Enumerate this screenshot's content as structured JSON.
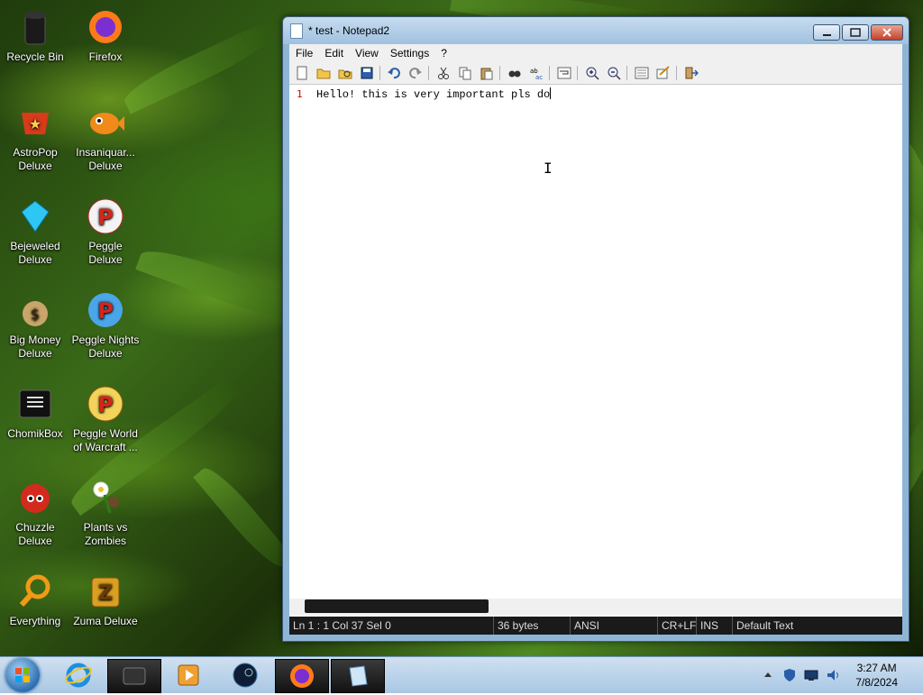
{
  "desktop": {
    "icons": [
      {
        "label": "Recycle Bin",
        "icon": "recycle-bin-icon"
      },
      {
        "label": "Firefox",
        "icon": "firefox-icon"
      },
      {
        "label": "AstroPop Deluxe",
        "icon": "astropop-icon"
      },
      {
        "label": "Insaniquar... Deluxe",
        "icon": "insaniquarium-icon"
      },
      {
        "label": "Bejeweled Deluxe",
        "icon": "bejeweled-icon"
      },
      {
        "label": "Peggle Deluxe",
        "icon": "peggle-icon"
      },
      {
        "label": "Big Money Deluxe",
        "icon": "big-money-icon"
      },
      {
        "label": "Peggle Nights Deluxe",
        "icon": "peggle-nights-icon"
      },
      {
        "label": "ChomikBox",
        "icon": "chomikbox-icon"
      },
      {
        "label": "Peggle World of Warcraft ...",
        "icon": "peggle-wow-icon"
      },
      {
        "label": "Chuzzle Deluxe",
        "icon": "chuzzle-icon"
      },
      {
        "label": "Plants vs Zombies",
        "icon": "plants-vs-zombies-icon"
      },
      {
        "label": "Everything",
        "icon": "everything-icon"
      },
      {
        "label": "Zuma Deluxe",
        "icon": "zuma-icon"
      }
    ]
  },
  "window": {
    "title": "* test - Notepad2",
    "menu": [
      "File",
      "Edit",
      "View",
      "Settings",
      "?"
    ],
    "toolbar": [
      "new-icon",
      "open-icon",
      "browse-icon",
      "save-icon",
      "undo-icon",
      "redo-icon",
      "cut-icon",
      "copy-icon",
      "paste-icon",
      "find-icon",
      "replace-icon",
      "word-wrap-icon",
      "zoom-in-icon",
      "zoom-out-icon",
      "scheme-icon",
      "customize-icon",
      "exit-icon"
    ],
    "editor": {
      "line_number": "1",
      "text": "Hello! this is very important pls do"
    },
    "status": {
      "position": "Ln 1 : 1   Col 37   Sel 0",
      "size": "36 bytes",
      "encoding": "ANSI",
      "eol": "CR+LF",
      "mode": "INS",
      "scheme": "Default Text"
    }
  },
  "taskbar": {
    "apps": [
      "start-orb",
      "internet-explorer-icon",
      "chomikbox-taskbar-icon",
      "media-player-icon",
      "steam-icon",
      "firefox-icon",
      "notepad2-icon"
    ],
    "clock_time": "3:27 AM",
    "clock_date": "7/8/2024"
  },
  "colors": {
    "line_number": "#cc0000",
    "status_bg": "#1a1a1a",
    "titlebar": "#b7d1ea"
  }
}
